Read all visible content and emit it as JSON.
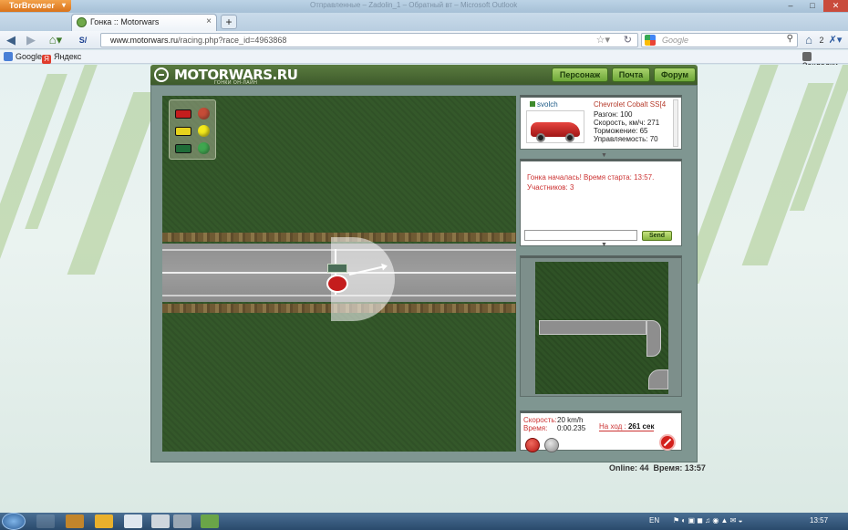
{
  "browser": {
    "app_button": "TorBrowser",
    "faded_title": "Отправленные – Zadolin_1 – Обратный вт – Microsoft Outlook",
    "tab_title": "Гонка :: Motorwars",
    "new_tab": "+",
    "url_domain": "www.motorwars.ru",
    "url_path": "/racing.php?race_id=4963868",
    "search_placeholder": "Google",
    "addon_count": "2",
    "bookmarks": [
      "Google",
      "Яндекс"
    ],
    "bookmarks_menu": "Закладки"
  },
  "site": {
    "logo": "MOTORWARS.RU",
    "logo_sub": "ГОНКИ ОН-ЛАЙН",
    "menu": [
      "Персонаж",
      "Почта",
      "Форум"
    ]
  },
  "car_panel": {
    "username": "svolch",
    "car_name": "Chevrolet Cobalt SS[4",
    "stats": [
      "Разгон: 100",
      "Скорость, км/ч: 271",
      "Торможение: 65",
      "Управляемость: 70"
    ]
  },
  "chat": {
    "messages": [
      "Гонка началась! Время старта: 13:57.",
      "Участников: 3"
    ],
    "input_value": "",
    "send_label": "Send"
  },
  "status": {
    "speed_label": "Скорость:",
    "speed_value": "20 km/h",
    "time_label": "Время:",
    "time_value": "0:00.235",
    "turn_label": "На ход :",
    "turn_value": "261 сек"
  },
  "footer": {
    "online": "Online: 44",
    "time": "Время: 13:57"
  },
  "lights": [
    {
      "car": "#c41d1d",
      "lamp": "#e23a2a",
      "dim": true
    },
    {
      "car": "#e6d21c",
      "lamp": "#f4ea1c",
      "dim": false
    },
    {
      "car": "#1f6d38",
      "lamp": "#2fb34a",
      "dim": true
    }
  ],
  "taskbar": {
    "lang": "EN",
    "clock": "13:57"
  }
}
